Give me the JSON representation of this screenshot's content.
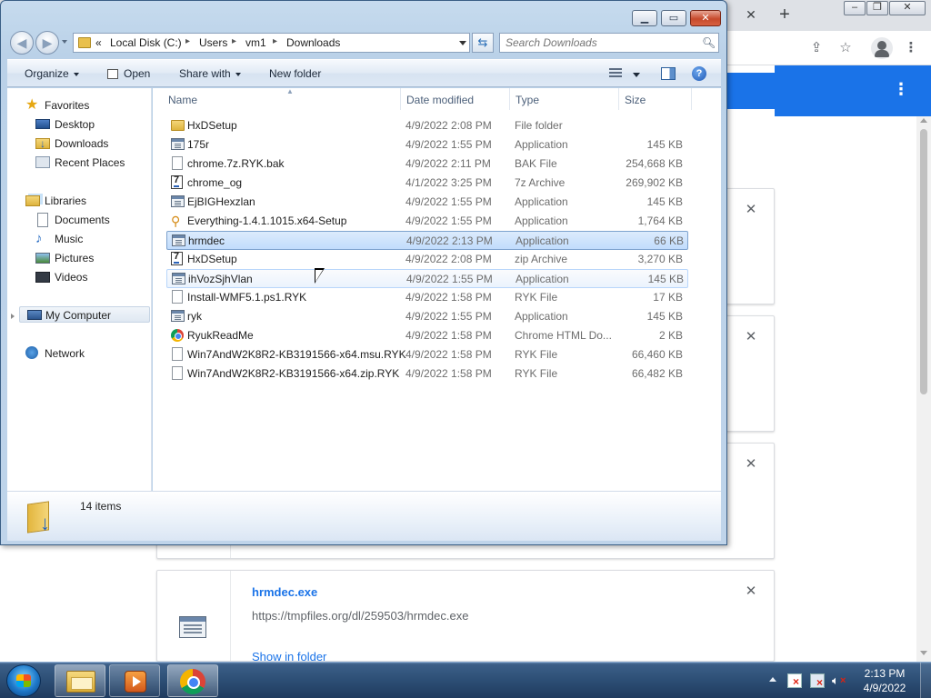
{
  "explorer": {
    "breadcrumb": {
      "overflow": "«",
      "parts": [
        "Local Disk (C:)",
        "Users",
        "vm1",
        "Downloads"
      ]
    },
    "search_placeholder": "Search Downloads",
    "commands": {
      "organize": "Organize",
      "open": "Open",
      "share_with": "Share with",
      "new_folder": "New folder"
    },
    "nav": {
      "favorites": "Favorites",
      "desktop": "Desktop",
      "downloads": "Downloads",
      "recent_places": "Recent Places",
      "libraries": "Libraries",
      "documents": "Documents",
      "music": "Music",
      "pictures": "Pictures",
      "videos": "Videos",
      "my_computer": "My Computer",
      "network": "Network"
    },
    "columns": {
      "name": "Name",
      "date": "Date modified",
      "type": "Type",
      "size": "Size"
    },
    "files": [
      {
        "name": "HxDSetup",
        "date": "4/9/2022 2:08 PM",
        "type": "File folder",
        "size": "",
        "icon": "folder-icon"
      },
      {
        "name": "175r",
        "date": "4/9/2022 1:55 PM",
        "type": "Application",
        "size": "145 KB",
        "icon": "application-icon"
      },
      {
        "name": "chrome.7z.RYK.bak",
        "date": "4/9/2022 2:11 PM",
        "type": "BAK File",
        "size": "254,668 KB",
        "icon": "blank-file-icon"
      },
      {
        "name": "chrome_og",
        "date": "4/1/2022 3:25 PM",
        "type": "7z Archive",
        "size": "269,902 KB",
        "icon": "7z-archive-icon"
      },
      {
        "name": "EjBIGHexzlan",
        "date": "4/9/2022 1:55 PM",
        "type": "Application",
        "size": "145 KB",
        "icon": "application-icon"
      },
      {
        "name": "Everything-1.4.1.1015.x64-Setup",
        "date": "4/9/2022 1:55 PM",
        "type": "Application",
        "size": "1,764 KB",
        "icon": "everything-search-icon"
      },
      {
        "name": "hrmdec",
        "date": "4/9/2022 2:13 PM",
        "type": "Application",
        "size": "66 KB",
        "icon": "application-icon"
      },
      {
        "name": "HxDSetup",
        "date": "4/9/2022 2:08 PM",
        "type": "zip Archive",
        "size": "3,270 KB",
        "icon": "7z-archive-icon"
      },
      {
        "name": "ihVozSjhVlan",
        "date": "4/9/2022 1:55 PM",
        "type": "Application",
        "size": "145 KB",
        "icon": "application-icon"
      },
      {
        "name": "Install-WMF5.1.ps1.RYK",
        "date": "4/9/2022 1:58 PM",
        "type": "RYK File",
        "size": "17 KB",
        "icon": "blank-file-icon"
      },
      {
        "name": "ryk",
        "date": "4/9/2022 1:55 PM",
        "type": "Application",
        "size": "145 KB",
        "icon": "application-icon"
      },
      {
        "name": "RyukReadMe",
        "date": "4/9/2022 1:58 PM",
        "type": "Chrome HTML Do...",
        "size": "2 KB",
        "icon": "chrome-icon"
      },
      {
        "name": "Win7AndW2K8R2-KB3191566-x64.msu.RYK",
        "date": "4/9/2022 1:58 PM",
        "type": "RYK File",
        "size": "66,460 KB",
        "icon": "blank-file-icon"
      },
      {
        "name": "Win7AndW2K8R2-KB3191566-x64.zip.RYK",
        "date": "4/9/2022 1:58 PM",
        "type": "RYK File",
        "size": "66,482 KB",
        "icon": "blank-file-icon"
      }
    ],
    "status": "14 items"
  },
  "chrome": {
    "download_card": {
      "filename": "hrmdec.exe",
      "url": "https://tmpfiles.org/dl/259503/hrmdec.exe",
      "show_in_folder": "Show in folder"
    },
    "colors": {
      "accent": "#1a73e8"
    }
  },
  "taskbar": {
    "time": "2:13 PM",
    "date": "4/9/2022"
  }
}
